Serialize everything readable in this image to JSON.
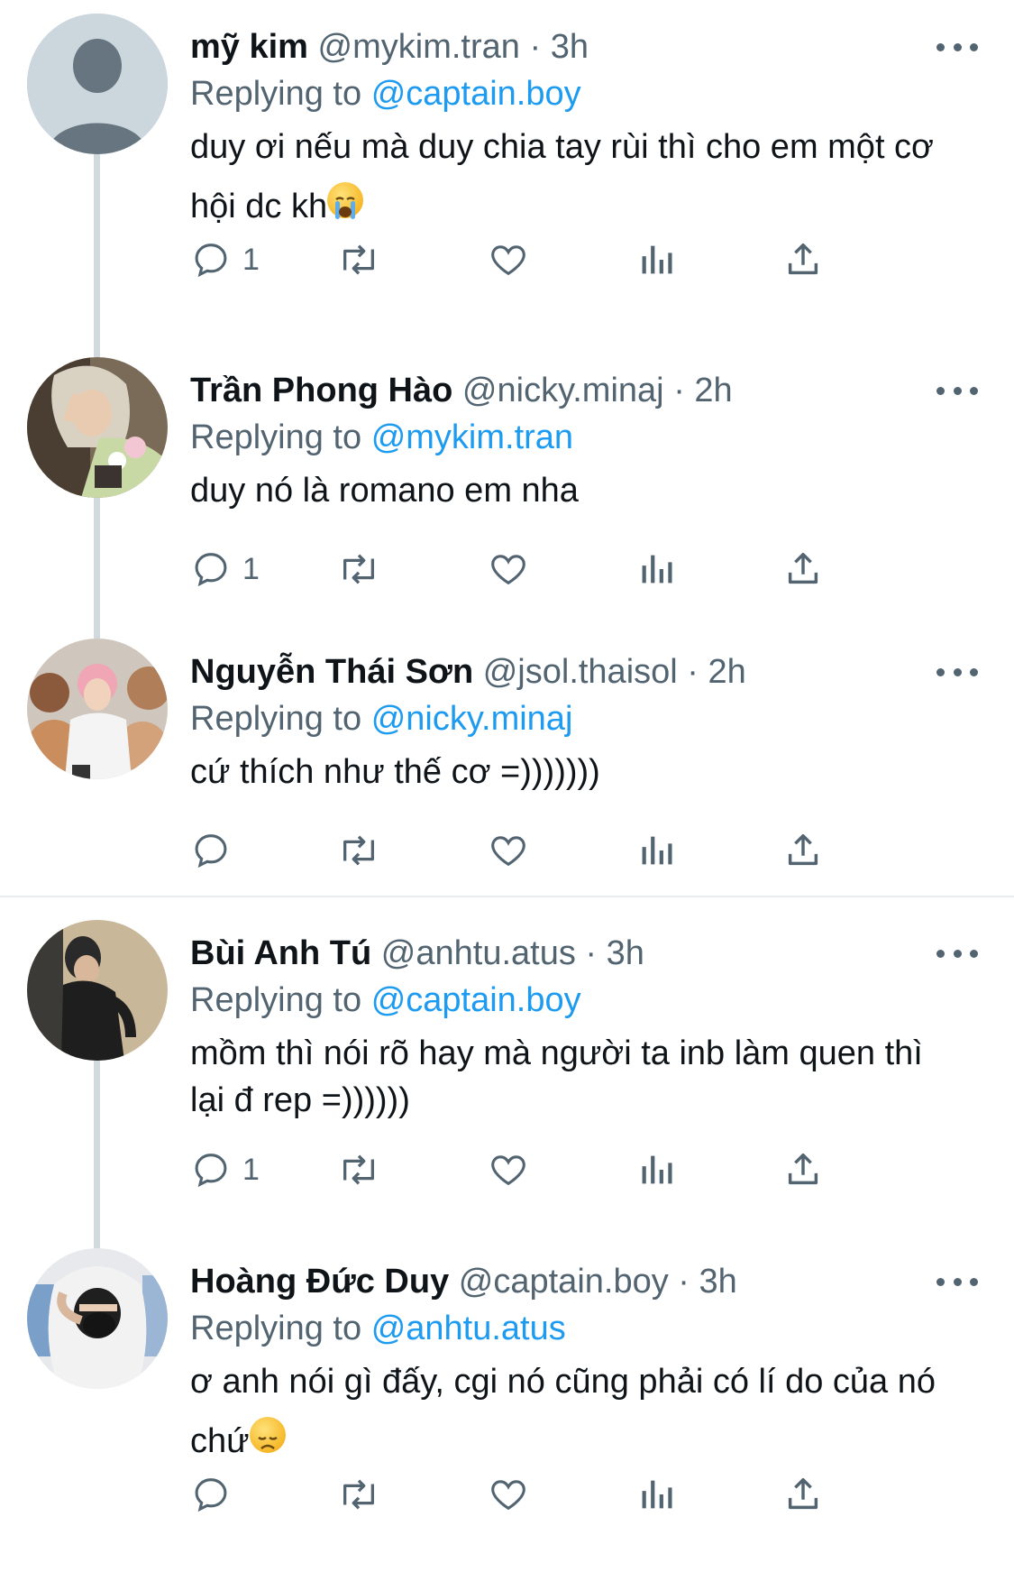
{
  "colors": {
    "text": "#0f1419",
    "muted": "#536471",
    "link": "#1d9bf0",
    "line": "#cfd9de"
  },
  "tweets": [
    {
      "name": "mỹ kim",
      "handle": "@mykim.tran",
      "time": "3h",
      "replying_prefix": "Replying to",
      "replying_to": "@captain.boy",
      "text": "duy ơi nếu mà duy chia tay rùi thì cho em một cơ hội dc kh",
      "emoji": "loudly-crying-face",
      "reply_count": "1"
    },
    {
      "name": "Trần Phong Hào",
      "handle": "@nicky.minaj",
      "time": "2h",
      "replying_prefix": "Replying to",
      "replying_to": "@mykim.tran",
      "text": "duy nó là romano em nha",
      "reply_count": "1"
    },
    {
      "name": "Nguyễn Thái Sơn",
      "handle": "@jsol.thaisol",
      "time": "2h",
      "replying_prefix": "Replying to",
      "replying_to": "@nicky.minaj",
      "text": "cứ thích như thế cơ =)))))))",
      "reply_count": ""
    },
    {
      "name": "Bùi Anh Tú",
      "handle": "@anhtu.atus",
      "time": "3h",
      "replying_prefix": "Replying to",
      "replying_to": "@captain.boy",
      "text": "mồm thì nói rõ hay mà người ta inb làm quen thì lại đ rep =))))))",
      "reply_count": "1"
    },
    {
      "name": "Hoàng Đức Duy",
      "handle": "@captain.boy",
      "time": "3h",
      "replying_prefix": "Replying to",
      "replying_to": "@anhtu.atus",
      "text": "ơ anh nói gì đấy, cgi nó cũng phải có lí do của nó chứ",
      "emoji": "disappointed-face",
      "reply_count": ""
    }
  ],
  "meta_separator": "·"
}
